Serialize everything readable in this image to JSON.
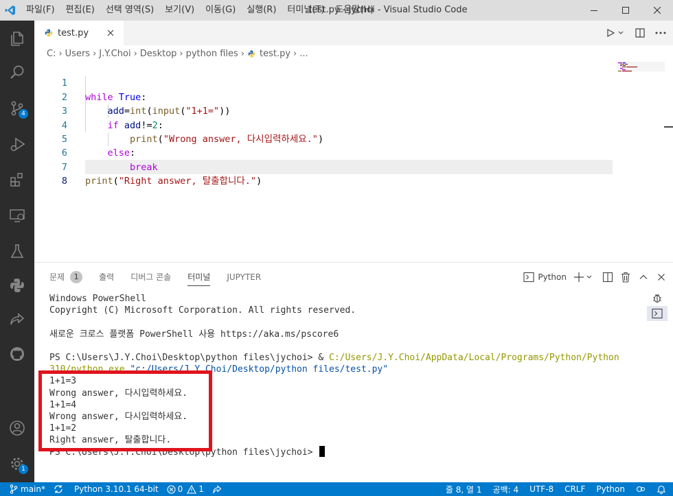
{
  "window": {
    "title": "test.py - jychoi - Visual Studio Code",
    "menu": [
      "파일(F)",
      "편집(E)",
      "선택 영역(S)",
      "보기(V)",
      "이동(G)",
      "실행(R)",
      "터미널(T)",
      "도움말(H)"
    ]
  },
  "activity": {
    "source_control_badge": "4",
    "manage_badge": "1"
  },
  "editor": {
    "tab_label": "test.py",
    "breadcrumb": [
      "C:",
      "Users",
      "J.Y.Choi",
      "Desktop",
      "python files",
      "test.py",
      "..."
    ],
    "line_numbers": [
      "1",
      "2",
      "3",
      "4",
      "5",
      "6",
      "7",
      "8"
    ],
    "code": {
      "l1_kw": "while",
      "l1_const": "True",
      "l1_end": ":",
      "l2_var": "add",
      "l2_op": "=",
      "l2_fn1": "int",
      "l2_p1": "(",
      "l2_fn2": "input",
      "l2_p2": "(",
      "l2_str": "\"1+1=\"",
      "l2_p3": "))",
      "l3_kw": "if",
      "l3_var": "add",
      "l3_op": "!=",
      "l3_num": "2",
      "l3_end": ":",
      "l4_fn": "print",
      "l4_p1": "(",
      "l4_str": "\"Wrong answer, 다시입력하세요.\"",
      "l4_p2": ")",
      "l5_kw": "else",
      "l5_end": ":",
      "l6_kw": "break",
      "l7_fn": "print",
      "l7_p1": "(",
      "l7_str": "\"Right answer, 탈출합니다.\"",
      "l7_p2": ")"
    }
  },
  "panel": {
    "tabs": [
      "문제",
      "출력",
      "디버그 콘솔",
      "터미널",
      "JUPYTER"
    ],
    "problems_badge": "1",
    "terminal_profile": "Python",
    "terminal": {
      "l1": "Windows PowerShell",
      "l2": "Copyright (C) Microsoft Corporation. All rights reserved.",
      "l3": "",
      "l4": "새로운 크로스 플랫폼 PowerShell 사용 https://aka.ms/pscore6",
      "l5": "",
      "l6_prompt": "PS C:\\Users\\J.Y.Choi\\Desktop\\python files\\jychoi> & ",
      "l6_path": "C:/Users/J.Y.Choi/AppData/Local/Programs/Python/Python",
      "l7_path": "310/python.exe",
      "l7_arg": "\"c:/Users/J.Y.Choi/Desktop/python files/test.py\"",
      "l8": "1+1=3",
      "l9": "Wrong answer, 다시입력하세요.",
      "l10": "1+1=4",
      "l11": "Wrong answer, 다시입력하세요.",
      "l12": "1+1=2",
      "l13": "Right answer, 탈출합니다.",
      "l14": "PS C:\\Users\\J.Y.Choi\\Desktop\\python files\\jychoi> "
    }
  },
  "status": {
    "branch": "main*",
    "python": "Python 3.10.1 64-bit",
    "errors": "0",
    "warnings": "1",
    "cursor_pos": "줄 8, 열 1",
    "spaces": "공백: 4",
    "encoding": "UTF-8",
    "eol": "CRLF",
    "language": "Python"
  },
  "colors": {
    "accent": "#007acc",
    "highlight_box": "#e0141e",
    "activity_bar": "#2c2c2c"
  }
}
